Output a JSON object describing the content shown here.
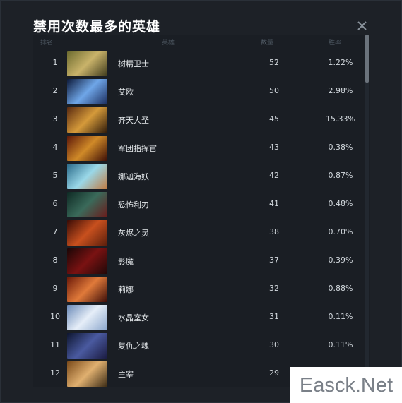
{
  "dialog": {
    "title": "禁用次数最多的英雄"
  },
  "table": {
    "headers": {
      "rank": "排名",
      "hero": "英雄",
      "count": "数量",
      "rate": "胜率"
    },
    "rows": [
      {
        "rank": "1",
        "hero": "树精卫士",
        "count": "52",
        "rate": "1.22%"
      },
      {
        "rank": "2",
        "hero": "艾欧",
        "count": "50",
        "rate": "2.98%"
      },
      {
        "rank": "3",
        "hero": "齐天大圣",
        "count": "45",
        "rate": "15.33%"
      },
      {
        "rank": "4",
        "hero": "军团指挥官",
        "count": "43",
        "rate": "0.38%"
      },
      {
        "rank": "5",
        "hero": "娜迦海妖",
        "count": "42",
        "rate": "0.87%"
      },
      {
        "rank": "6",
        "hero": "恐怖利刃",
        "count": "41",
        "rate": "0.48%"
      },
      {
        "rank": "7",
        "hero": "灰烬之灵",
        "count": "38",
        "rate": "0.70%"
      },
      {
        "rank": "8",
        "hero": "影魔",
        "count": "37",
        "rate": "0.39%"
      },
      {
        "rank": "9",
        "hero": "莉娜",
        "count": "32",
        "rate": "0.88%"
      },
      {
        "rank": "10",
        "hero": "水晶室女",
        "count": "31",
        "rate": "0.11%"
      },
      {
        "rank": "11",
        "hero": "复仇之魂",
        "count": "30",
        "rate": "0.11%"
      },
      {
        "rank": "12",
        "hero": "主宰",
        "count": "29",
        "rate": ""
      }
    ]
  },
  "watermark": {
    "text": "Easck.Net"
  },
  "colors": {
    "background": "#1d2127",
    "title": "#ffffff",
    "header": "#4c5660",
    "text": "#d3d9de"
  }
}
